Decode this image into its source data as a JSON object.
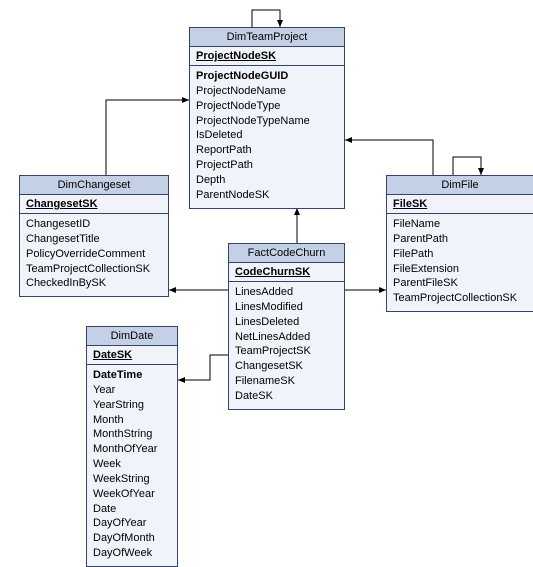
{
  "entities": {
    "dimTeamProject": {
      "title": "DimTeamProject",
      "key": "ProjectNodeSK",
      "fields": [
        "ProjectNodeGUID",
        "ProjectNodeName",
        "ProjectNodeType",
        "ProjectNodeTypeName",
        "IsDeleted",
        "ReportPath",
        "ProjectPath",
        "Depth",
        "ParentNodeSK"
      ],
      "firstBold": true
    },
    "dimChangeset": {
      "title": "DimChangeset",
      "key": "ChangesetSK",
      "fields": [
        "ChangesetID",
        "ChangesetTitle",
        "PolicyOverrideComment",
        "TeamProjectCollectionSK",
        "CheckedInBySK"
      ],
      "firstBold": false
    },
    "dimFile": {
      "title": "DimFile",
      "key": "FileSK",
      "fields": [
        "FileName",
        "ParentPath",
        "FilePath",
        "FileExtension",
        "ParentFileSK",
        "TeamProjectCollectionSK"
      ],
      "firstBold": false
    },
    "factCodeChurn": {
      "title": "FactCodeChurn",
      "key": "CodeChurnSK",
      "fields": [
        "LinesAdded",
        "LinesModified",
        "LinesDeleted",
        "NetLinesAdded",
        "TeamProjectSK",
        "ChangesetSK",
        "FilenameSK",
        "DateSK"
      ],
      "firstBold": false
    },
    "dimDate": {
      "title": "DimDate",
      "key": "DateSK",
      "fields": [
        "DateTime",
        "Year",
        "YearString",
        "Month",
        "MonthString",
        "MonthOfYear",
        "Week",
        "WeekString",
        "WeekOfYear",
        "Date",
        "DayOfYear",
        "DayOfMonth",
        "DayOfWeek"
      ],
      "firstBold": true
    }
  }
}
